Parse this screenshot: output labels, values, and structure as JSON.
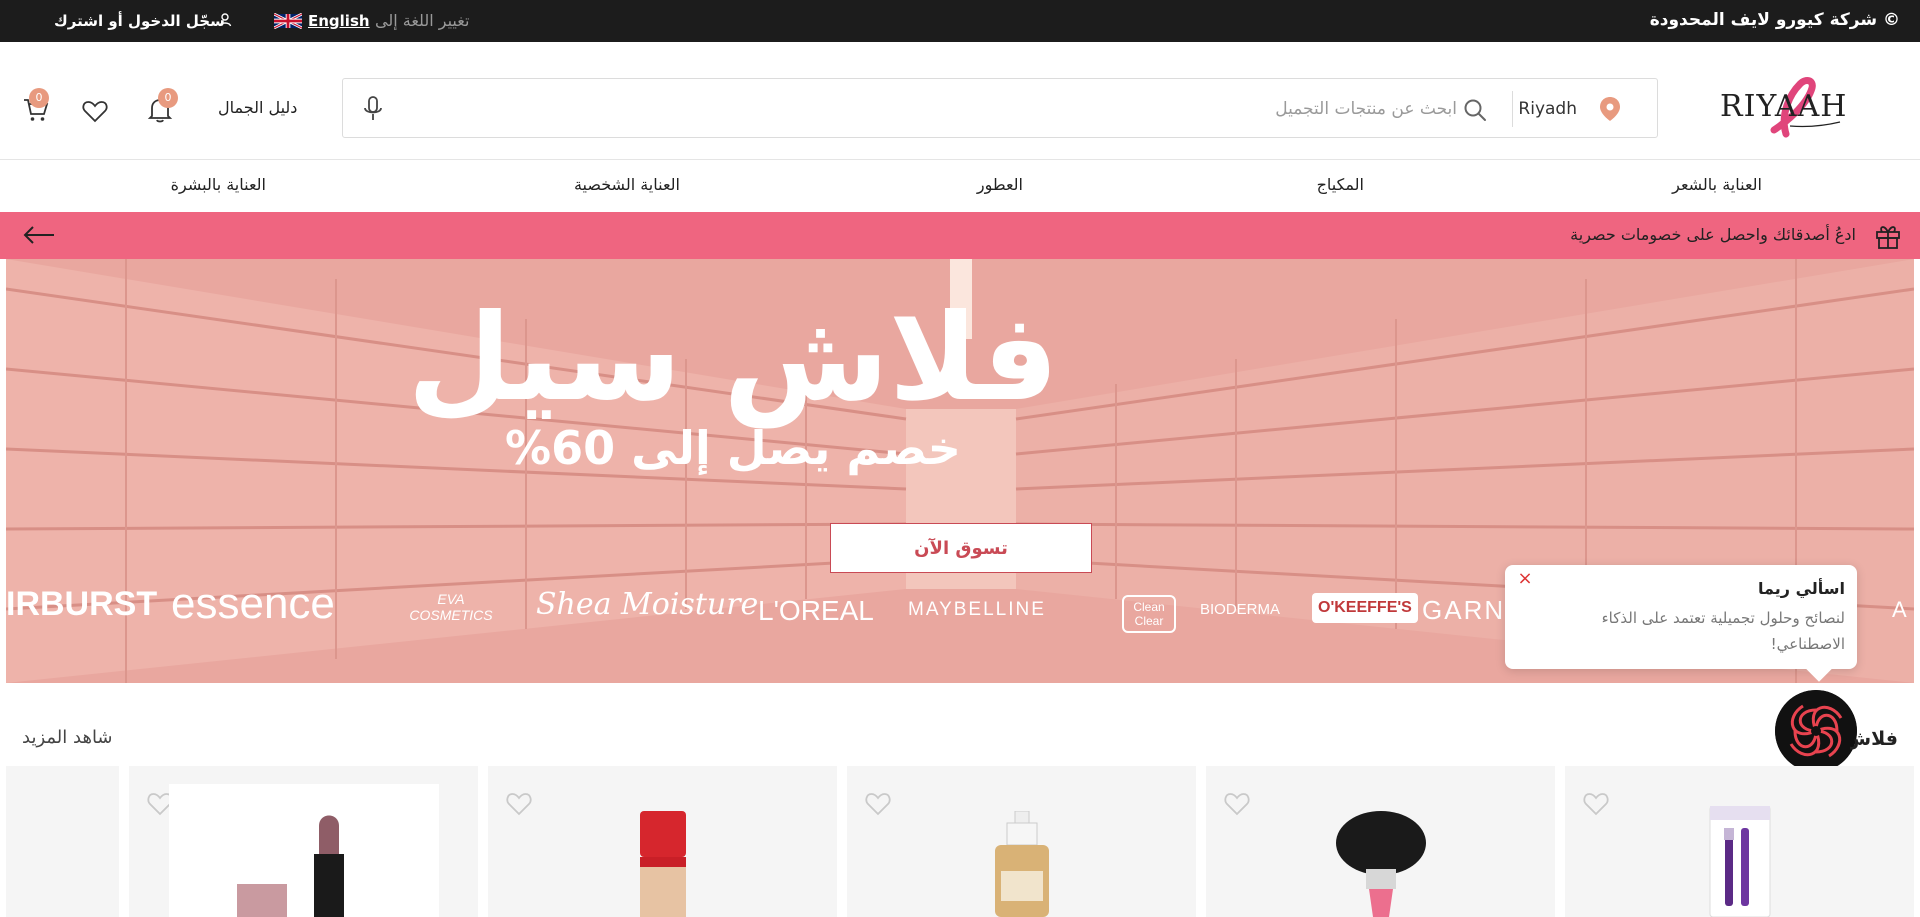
{
  "topbar": {
    "copyright": "© شركة كيورو لايف المحدودة",
    "login_label": "سجّل الدخول أو اشترك",
    "language_label": "English",
    "change_language": "تغيير اللغة إلى"
  },
  "header": {
    "brand_name": "RIYAAH",
    "location": "Riyadh",
    "search_placeholder": "ابحث عن منتجات التجميل",
    "beauty_guide": "دليل الجمال",
    "notifications_count": "0",
    "cart_count": "0"
  },
  "nav": {
    "items": [
      "العناية بالشعر",
      "المكياج",
      "العطور",
      "العناية الشخصية",
      "العناية بالبشرة"
    ]
  },
  "promo": {
    "text": "ادعُ أصدقائك واحصل على خصومات حصرية"
  },
  "hero": {
    "title": "فلاش سيل",
    "subtitle": "خصم يصل إلى 60%",
    "cta": "تسوق الآن",
    "brands": [
      "IRBURST",
      "essence",
      "EVA COSMETICS",
      "Shea Moisture",
      "L'OREAL",
      "MAYBELLINE",
      "Clean Clear",
      "BIODERMA",
      "O'KEEFFE'S",
      "GARNIER",
      "A"
    ]
  },
  "chat": {
    "name": "اسألي ريما",
    "message": "لنصائح وحلول تجميلية تعتمد على الذكاء الاصطناعي!",
    "close": "×"
  },
  "section": {
    "title": "فلاش سيل",
    "see_more": "شاهد المزيد"
  },
  "colors": {
    "topbar": "#1c1c1c",
    "promo": "#ef6580",
    "accent": "#c94a55",
    "badge": "#e89a7f"
  }
}
